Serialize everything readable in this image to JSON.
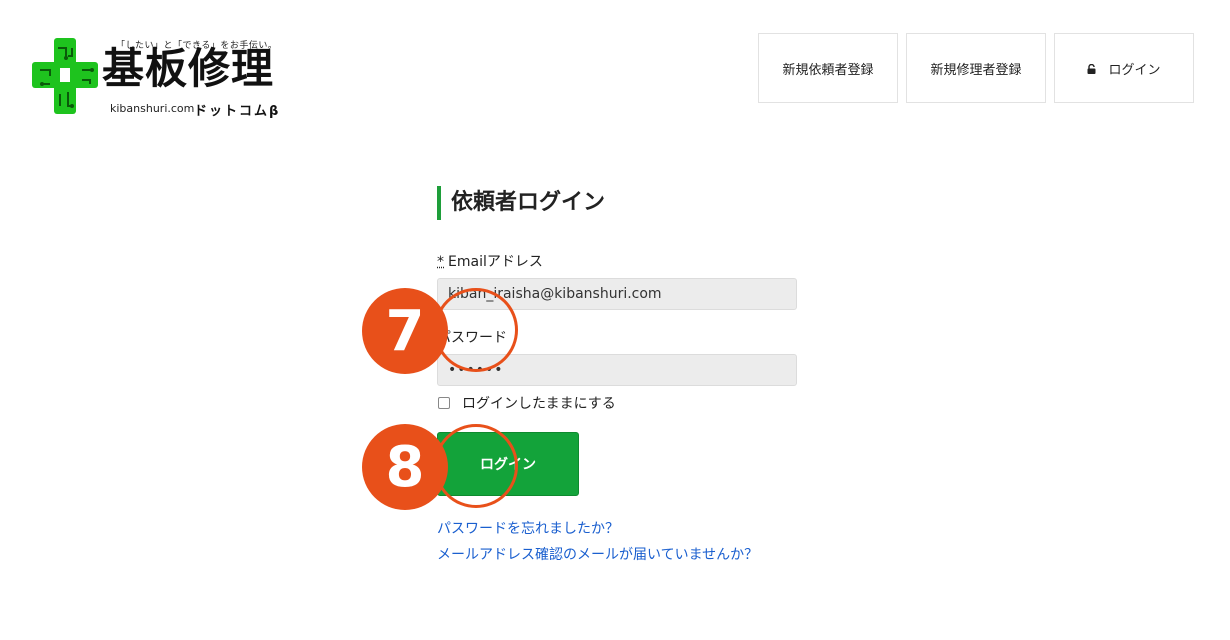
{
  "logo": {
    "tagline": "「したい」と「できる」をお手伝い。",
    "title": "基板修理",
    "domain": "kibanshuri.com",
    "suffix": "ドットコムβ",
    "color": "#1ec31e"
  },
  "header": {
    "nav": [
      {
        "label": "新規依頼者登録"
      },
      {
        "label": "新規修理者登録"
      },
      {
        "label": "ログイン",
        "icon": "lock-icon"
      }
    ]
  },
  "form": {
    "title": "依頼者ログイン",
    "email_required_mark": "*",
    "email_label": "Emailアドレス",
    "email_value": "kiban_irаisha@kibanshuri.com",
    "password_label": "パスワード",
    "password_value": "••••••",
    "remember_label": "ログインしたままにする",
    "submit_label": "ログイン",
    "forgot_link": "パスワードを忘れましたか？",
    "confirm_link": "メールアドレス確認のメールが届いていませんか？",
    "accent_color": "#13a33a"
  },
  "annotations": {
    "step_7": "7",
    "step_8": "8",
    "color": "#e8501a"
  }
}
